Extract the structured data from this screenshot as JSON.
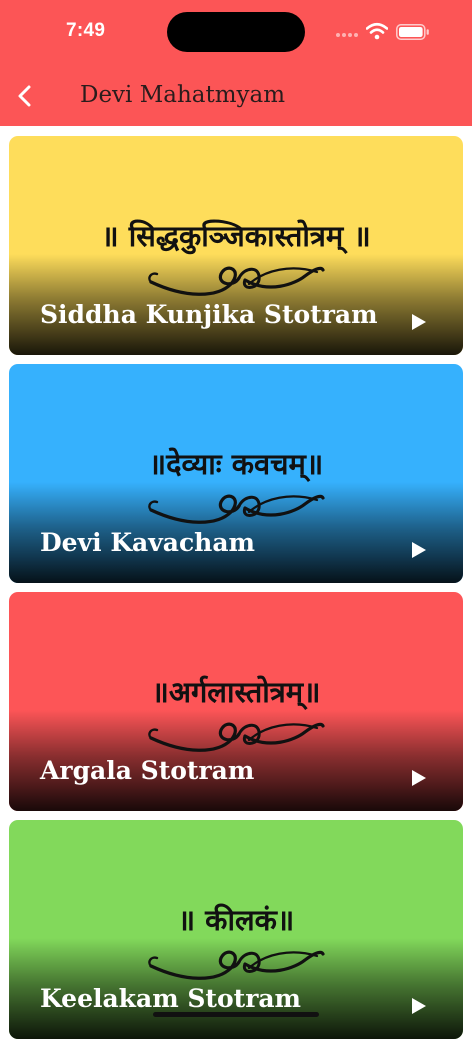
{
  "status_bar": {
    "time": "7:49"
  },
  "nav": {
    "title": "Devi Mahatmyam",
    "back_icon": "chevron-left-icon"
  },
  "cards": [
    {
      "sanskrit": "॥ सिद्धकुञ्जिकास्तोत्रम् ॥",
      "title": "Siddha Kunjika Stotram",
      "color": "#fedd5b"
    },
    {
      "sanskrit": "॥देव्याः कवचम्॥",
      "title": "Devi Kavacham",
      "color": "#36b1fd"
    },
    {
      "sanskrit": "॥अर्गलास्तोत्रम्॥",
      "title": "Argala Stotram",
      "color": "#fd5557"
    },
    {
      "sanskrit": "॥ कीलकं॥",
      "title": "Keelakam Stotram",
      "color": "#82d95b"
    }
  ],
  "colors": {
    "header": "#fc5556",
    "title_text": "#ffffff"
  },
  "icons": {
    "play": "play-icon",
    "ornament": "flourish-ornament-icon",
    "wifi": "wifi-icon",
    "battery": "battery-icon"
  }
}
